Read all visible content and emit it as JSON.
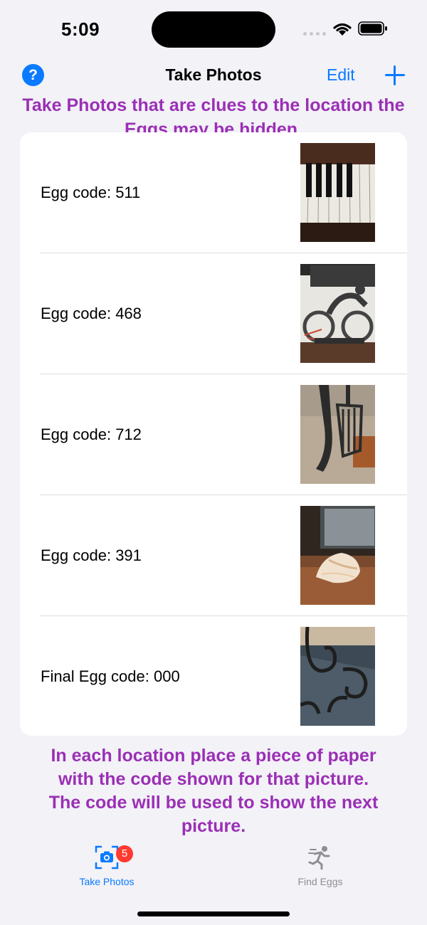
{
  "status_bar": {
    "time": "5:09"
  },
  "nav": {
    "help_label": "?",
    "title": "Take Photos",
    "edit_label": "Edit"
  },
  "instruction_top": "Take Photos that are clues to the location the Eggs may be hidden.",
  "list": {
    "rows": [
      {
        "label": "Egg code: 511",
        "photo": "piano-keys-photo"
      },
      {
        "label": "Egg code: 468",
        "photo": "bicycle-sculpture-photo"
      },
      {
        "label": "Egg code: 712",
        "photo": "chair-leg-carpet-photo"
      },
      {
        "label": "Egg code: 391",
        "photo": "seashell-photo"
      },
      {
        "label": "Final Egg code: 000",
        "photo": "metal-scroll-photo"
      }
    ]
  },
  "instruction_bottom": "In each location place a piece of paper with the code shown for that picture. The code will be used to show the next picture.",
  "tab_bar": {
    "tabs": [
      {
        "label": "Take Photos",
        "icon": "camera-icon",
        "badge": "5",
        "selected": true
      },
      {
        "label": "Find Eggs",
        "icon": "runner-icon",
        "selected": false
      }
    ]
  },
  "colors": {
    "accent": "#0a7aff",
    "instruction": "#9b2fb5",
    "badge": "#ff3b30",
    "background": "#f2f2f7"
  }
}
